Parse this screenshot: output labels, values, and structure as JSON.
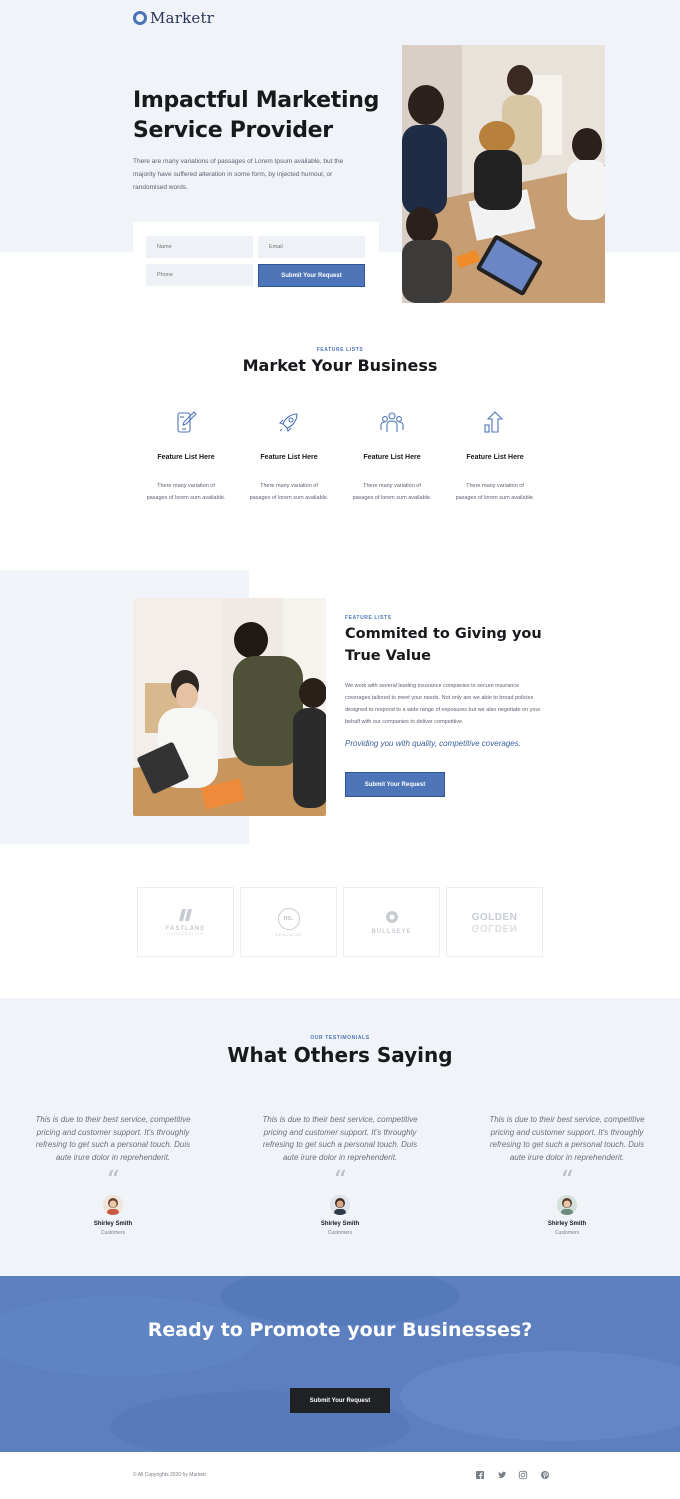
{
  "brand": {
    "name": "Marketr",
    "accent": "#4e75b8"
  },
  "hero": {
    "title": "Impactful Marketing Service Provider",
    "description": "There are many variations of passages of Lorem Ipsum available, but the majority have suffered alteration in some form, by injected humour, or randomised words.",
    "form": {
      "name_placeholder": "Name",
      "email_placeholder": "Email",
      "phone_placeholder": "Phone",
      "submit_label": "Submit Your Request"
    }
  },
  "features": {
    "eyebrow": "FEATURE LISTS",
    "title": "Market Your Business",
    "items": [
      {
        "icon": "mobile-edit-icon",
        "title": "Feature List Here",
        "description": "There many variation of pasages of lorem sum available."
      },
      {
        "icon": "rocket-icon",
        "title": "Feature List Here",
        "description": "There many variation of pasages of lorem sum available."
      },
      {
        "icon": "team-icon",
        "title": "Feature List Here",
        "description": "There many variation of pasages of lorem sum available."
      },
      {
        "icon": "growth-arrow-icon",
        "title": "Feature List Here",
        "description": "There many variation of pasages of lorem sum available."
      }
    ]
  },
  "value": {
    "eyebrow": "FEATURE LISTS",
    "title": "Commited to Giving you True Value",
    "description": "We work with several leading insurance companies to secure insurance coverages tailored to meet your needs. Not only are we able to broad policies designed to respond to a wide range of exposures but we also negotiate on your behalf with our companies to deliver competitive",
    "quote": "Providing you with quality, competitive coverages.",
    "button_label": "Submit Your Request"
  },
  "partners": [
    {
      "name": "FASTLANE",
      "sub": "CORPORATION"
    },
    {
      "name": "nc.",
      "sub": "NEWCALIB"
    },
    {
      "name": "BULLSEYE",
      "sub": ""
    },
    {
      "name": "GOLDEN",
      "sub": "GOLDEN"
    }
  ],
  "testimonials": {
    "eyebrow": "OUR TESTIMONIALS",
    "title": "What Others Saying",
    "items": [
      {
        "quote": "This is due to their best service, competitive pricing and customer support. It's throughly refresing to get such a personal touch. Duis aute irure dolor in reprehenderit.",
        "name": "Shirley Smith",
        "role": "Customers"
      },
      {
        "quote": "This is due to their best service, competitive pricing and customer support. It's throughly refresing to get such a personal touch. Duis aute irure dolor in reprehenderit.",
        "name": "Shirley Smith",
        "role": "Customers"
      },
      {
        "quote": "This is due to their best service, competitive pricing and customer support. It's throughly refresing to get such a personal touch. Duis aute irure dolor in reprehenderit.",
        "name": "Shirley Smith",
        "role": "Customers"
      }
    ]
  },
  "cta": {
    "title": "Ready to Promote your Businesses?",
    "button_label": "Submit Your Request"
  },
  "footer": {
    "copyright": "© All Copyrights 2020 by Marketr",
    "social": [
      "facebook-icon",
      "twitter-icon",
      "instagram-icon",
      "pinterest-icon"
    ]
  }
}
